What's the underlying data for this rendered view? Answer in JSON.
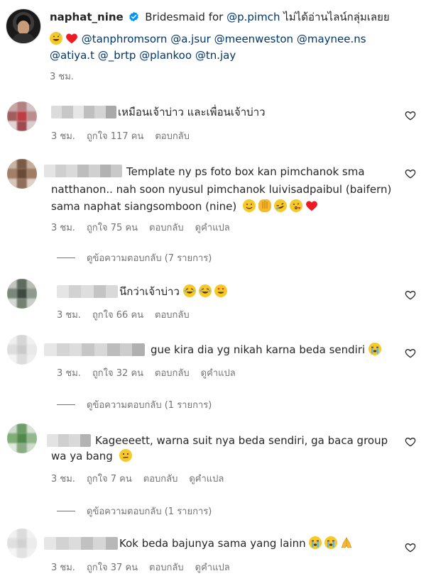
{
  "post": {
    "username": "naphat_nine",
    "caption_prefix": "Bridesmaid for",
    "mention_main": "@p.pimch",
    "caption_thai": "ไม่ได้อ่านไลน์กลุ่มเลยย",
    "mentions": [
      "@tanphromsorn",
      "@a.jsur",
      "@meenweston",
      "@maynee.ns",
      "@atiya.t",
      "@_brtp",
      "@plankoo",
      "@tn.jay"
    ],
    "time": "3 ชม."
  },
  "labels": {
    "reply": "ตอบกลับ",
    "translate": "ดูคำแปล",
    "heart_icon": "heart-outline-icon"
  },
  "comments": [
    {
      "text_lines": [
        "เหมือนเจ้าบ่าว และเพื่อนเจ้าบ่าว"
      ],
      "time": "3 ชม.",
      "likes": "ถูกใจ 117 คน",
      "show_translate": false
    },
    {
      "text_lines": [
        "Template ny ps foto box kan pimchanok sma",
        "natthanon.. nah soon nyusul pimchanok luivisadpaibul (baifern)",
        "sama naphat siangsomboon (nine)"
      ],
      "time": "3 ชม.",
      "likes": "ถูกใจ 75 คน",
      "show_translate": true,
      "replies": "ดูข้อความตอบกลับ (7 รายการ)"
    },
    {
      "text_lines": [
        "นึกว่าเจ้าบ่าว"
      ],
      "time": "3 ชม.",
      "likes": "ถูกใจ 66 คน",
      "show_translate": false
    },
    {
      "text_lines": [
        "gue kira dia yg nikah karna beda sendiri"
      ],
      "time": "3 ชม.",
      "likes": "ถูกใจ 32 คน",
      "show_translate": true,
      "replies": "ดูข้อความตอบกลับ (1 รายการ)"
    },
    {
      "text_lines": [
        "Kageeeett, warna suit nya beda sendiri, ga baca group",
        "wa ya bang"
      ],
      "time": "3 ชม.",
      "likes": "ถูกใจ 7 คน",
      "show_translate": true,
      "replies": "ดูข้อความตอบกลับ (1 รายการ)"
    },
    {
      "text_lines": [
        "Kok beda bajunya sama yang lainn"
      ],
      "time": "3 ชม.",
      "likes": "ถูกใจ 37 คน",
      "show_translate": true
    }
  ],
  "colors": {
    "text": "#262626",
    "secondary": "#737373",
    "mention": "#00376b",
    "verified": "#0095f6",
    "heart_red": "#ed1c24"
  }
}
